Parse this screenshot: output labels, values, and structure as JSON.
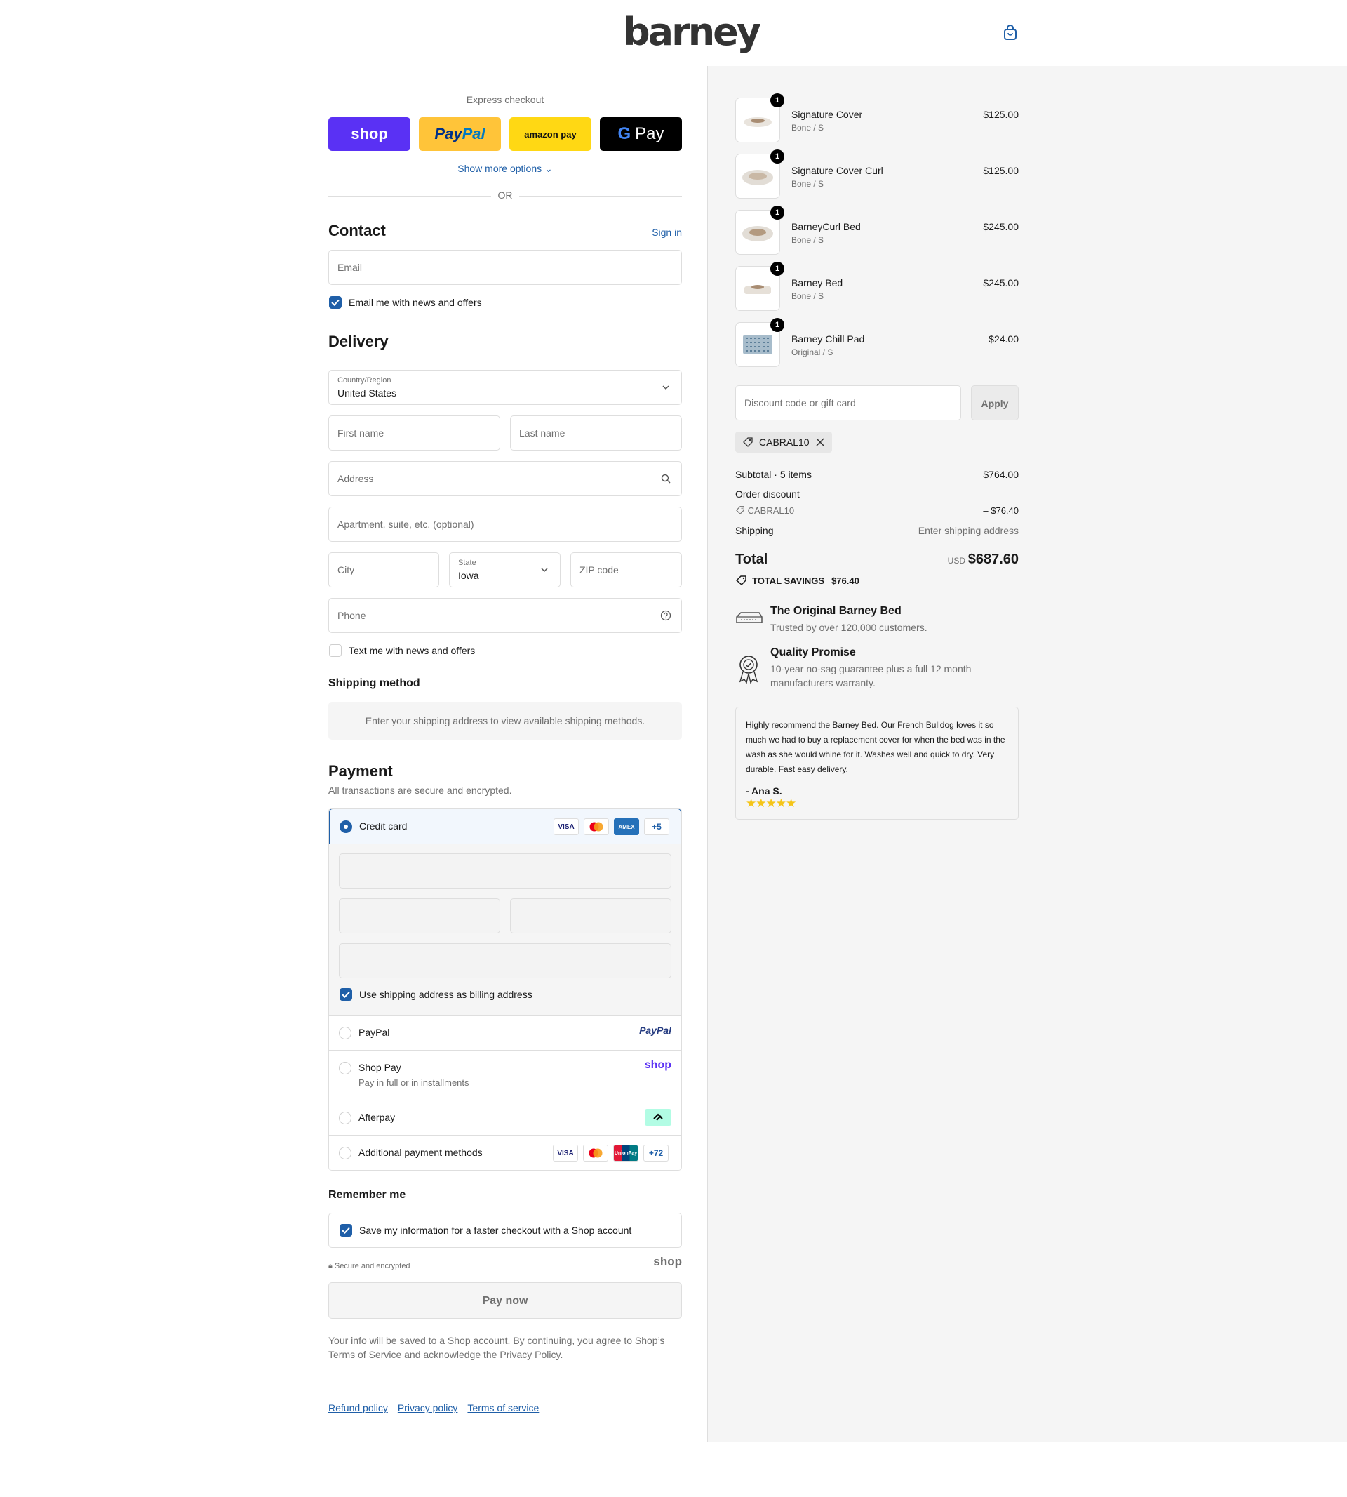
{
  "header": {
    "logo": "barney",
    "cart_icon": "shopping-bag-icon"
  },
  "express": {
    "title": "Express checkout",
    "buttons": [
      {
        "label": "shop",
        "color": "#5a31f4"
      },
      {
        "label": "PayPal",
        "color": "#ffc439"
      },
      {
        "label": "amazon pay",
        "color": "#ffd814"
      },
      {
        "label": "G Pay",
        "color": "#000000"
      }
    ],
    "show_more": "Show more options",
    "or": "OR"
  },
  "contact": {
    "heading": "Contact",
    "sign_in": "Sign in",
    "email_placeholder": "Email",
    "newsletter_label": "Email me with news and offers",
    "newsletter_checked": true
  },
  "delivery": {
    "heading": "Delivery",
    "country_label": "Country/Region",
    "country_value": "United States",
    "first_name": "First name",
    "last_name": "Last name",
    "address": "Address",
    "apartment": "Apartment, suite, etc. (optional)",
    "city": "City",
    "state_label": "State",
    "state_value": "Iowa",
    "zip": "ZIP code",
    "phone": "Phone",
    "text_label": "Text me with news and offers",
    "text_checked": false
  },
  "shipping_method": {
    "heading": "Shipping method",
    "message": "Enter your shipping address to view available shipping methods."
  },
  "payment": {
    "heading": "Payment",
    "subtitle": "All transactions are secure and encrypted.",
    "credit_card": {
      "label": "Credit card",
      "selected": true,
      "more": "+5"
    },
    "billing_same_label": "Use shipping address as billing address",
    "billing_same_checked": true,
    "paypal": {
      "label": "PayPal",
      "logo": "PayPal"
    },
    "shop_pay": {
      "label": "Shop Pay",
      "sub": "Pay in full or in installments",
      "logo": "shop"
    },
    "afterpay": {
      "label": "Afterpay"
    },
    "additional": {
      "label": "Additional payment methods",
      "more": "+72"
    },
    "card_logos": {
      "visa": "VISA",
      "amex": "AMEX",
      "unionpay": "UnionPay"
    }
  },
  "remember": {
    "heading": "Remember me",
    "save_label": "Save my information for a faster checkout with a Shop account",
    "save_checked": true,
    "secure": "Secure and encrypted",
    "shop_logo": "shop"
  },
  "pay_now": "Pay now",
  "consent": {
    "pre": "Your info will be saved to a Shop account. By continuing, you agree to Shop’s ",
    "terms": "Terms of Service",
    "mid": " and acknowledge the ",
    "privacy": "Privacy Policy",
    "post": "."
  },
  "footer_links": [
    "Refund policy",
    "Privacy policy",
    "Terms of service"
  ],
  "cart": {
    "items": [
      {
        "qty": "1",
        "name": "Signature Cover",
        "variant": "Bone / S",
        "price": "$125.00"
      },
      {
        "qty": "1",
        "name": "Signature Cover Curl",
        "variant": "Bone / S",
        "price": "$125.00"
      },
      {
        "qty": "1",
        "name": "BarneyCurl Bed",
        "variant": "Bone / S",
        "price": "$245.00"
      },
      {
        "qty": "1",
        "name": "Barney Bed",
        "variant": "Bone / S",
        "price": "$245.00"
      },
      {
        "qty": "1",
        "name": "Barney Chill Pad",
        "variant": "Original / S",
        "price": "$24.00"
      }
    ],
    "discount_placeholder": "Discount code or gift card",
    "apply": "Apply",
    "applied_code": "CABRAL10",
    "subtotal_label": "Subtotal · 5 items",
    "subtotal_value": "$764.00",
    "order_discount_label": "Order discount",
    "discount_code": "CABRAL10",
    "discount_value": "– $76.40",
    "shipping_label": "Shipping",
    "shipping_value": "Enter shipping address",
    "total_label": "Total",
    "currency": "USD",
    "total_value": "$687.60",
    "savings_label": "TOTAL SAVINGS",
    "savings_value": "$76.40"
  },
  "promos": [
    {
      "title": "The Original Barney Bed",
      "text": "Trusted by over 120,000 customers.",
      "icon": "bed-icon"
    },
    {
      "title": "Quality Promise",
      "text": "10-year no-sag guarantee plus a full 12 month manufacturers warranty.",
      "icon": "award-ribbon-icon"
    }
  ],
  "review": {
    "text": "Highly recommend the Barney Bed. Our French Bulldog loves it so much we had to buy a replacement cover for when the bed was in the wash as she would whine for it. Washes well and quick to dry. Very durable. Fast easy delivery.",
    "author": "- Ana S.",
    "stars": "★★★★★"
  }
}
